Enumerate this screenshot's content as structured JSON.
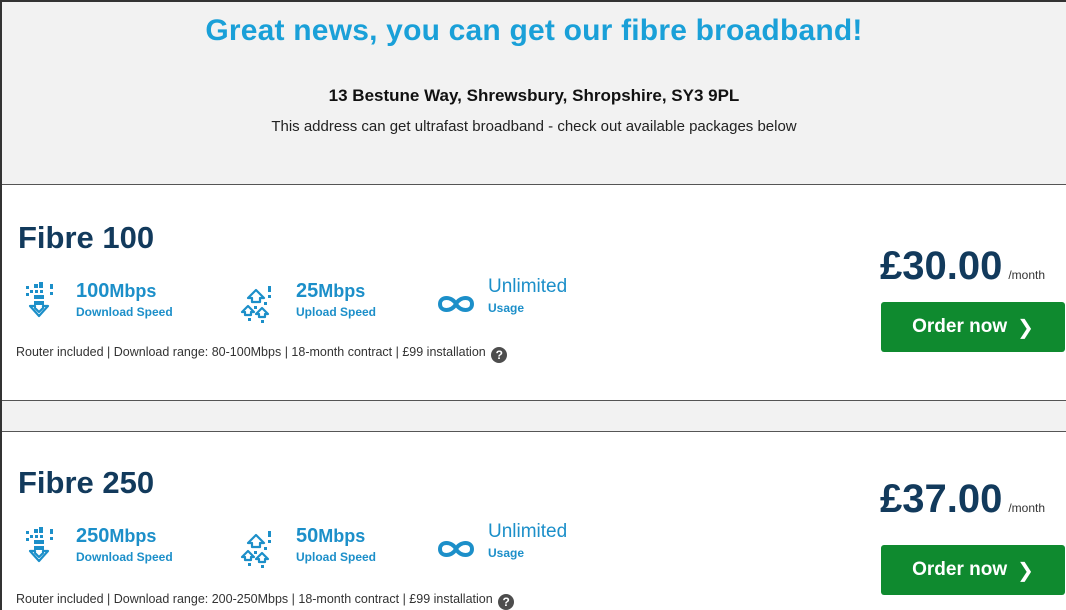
{
  "header": {
    "headline": "Great news, you can get our fibre broadband!",
    "address": "13 Bestune Way, Shrewsbury, Shropshire, SY3 9PL",
    "subtext": "This address can get ultrafast broadband - check out available packages below"
  },
  "packages": [
    {
      "name": "Fibre 100",
      "download_value": "100",
      "download_unit": "Mbps",
      "download_label": "Download Speed",
      "upload_value": "25",
      "upload_unit": "Mbps",
      "upload_label": "Upload Speed",
      "usage_value": "Unlimited",
      "usage_label": "Usage",
      "details": "Router included  |  Download range: 80-100Mbps  |  18-month contract  |  £99 installation",
      "price": "£30.00",
      "per": "/month",
      "order_label": "Order now"
    },
    {
      "name": "Fibre 250",
      "download_value": "250",
      "download_unit": "Mbps",
      "download_label": "Download Speed",
      "upload_value": "50",
      "upload_unit": "Mbps",
      "upload_label": "Upload Speed",
      "usage_value": "Unlimited",
      "usage_label": "Usage",
      "details": "Router included  |  Download range: 200-250Mbps  |  18-month contract  |  £99 installation",
      "price": "£37.00",
      "per": "/month",
      "order_label": "Order now"
    }
  ],
  "icons": {
    "download": "download-speed-icon",
    "upload": "upload-speed-icon",
    "usage": "infinity-icon",
    "help": "help-icon",
    "chevron": "chevron-right-icon"
  },
  "colors": {
    "headline": "#1aa0d8",
    "title": "#123a5c",
    "order_button": "#0f8a2f",
    "header_bg": "#f2f2f2"
  },
  "glyphs": {
    "help": "?",
    "chevron": "❯"
  }
}
